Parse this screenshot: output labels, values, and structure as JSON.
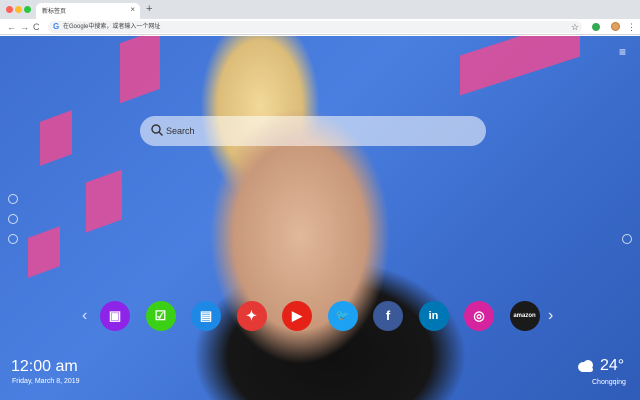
{
  "browser": {
    "tab_title": "新标签页",
    "tab_close": "×",
    "new_tab": "+",
    "omnibox_text": "在Google中搜索，或者输入一个网址",
    "back": "←",
    "forward": "→",
    "reload": "C",
    "star": "☆",
    "menu": "⋮"
  },
  "page": {
    "menu_icon": "≡",
    "search": {
      "placeholder": "Search"
    },
    "shortcuts": [
      {
        "name": "gallery-icon",
        "color": "#8e24e8",
        "glyph": "▣"
      },
      {
        "name": "todo-icon",
        "color": "#3bd016",
        "glyph": "☑"
      },
      {
        "name": "notes-icon",
        "color": "#1e88e5",
        "glyph": "▤"
      },
      {
        "name": "games-icon",
        "color": "#e53935",
        "glyph": "✦"
      },
      {
        "name": "youtube-icon",
        "color": "#e62117",
        "glyph": "▶"
      },
      {
        "name": "twitter-icon",
        "color": "#1da1f2",
        "glyph": "🐦"
      },
      {
        "name": "facebook-icon",
        "color": "#3b5998",
        "glyph": "f"
      },
      {
        "name": "linkedin-icon",
        "color": "#0077b5",
        "glyph": "in"
      },
      {
        "name": "instagram-icon",
        "color": "#d6249f",
        "glyph": "◎"
      },
      {
        "name": "amazon-icon",
        "color": "#1a1a1a",
        "glyph": "amazon"
      }
    ],
    "prev": "‹",
    "next": "›",
    "clock": {
      "time": "12:00 am",
      "date": "Friday, March 8, 2019"
    },
    "weather": {
      "temp": "24°",
      "city": "Chongqing",
      "icon": "cloud-icon"
    }
  }
}
